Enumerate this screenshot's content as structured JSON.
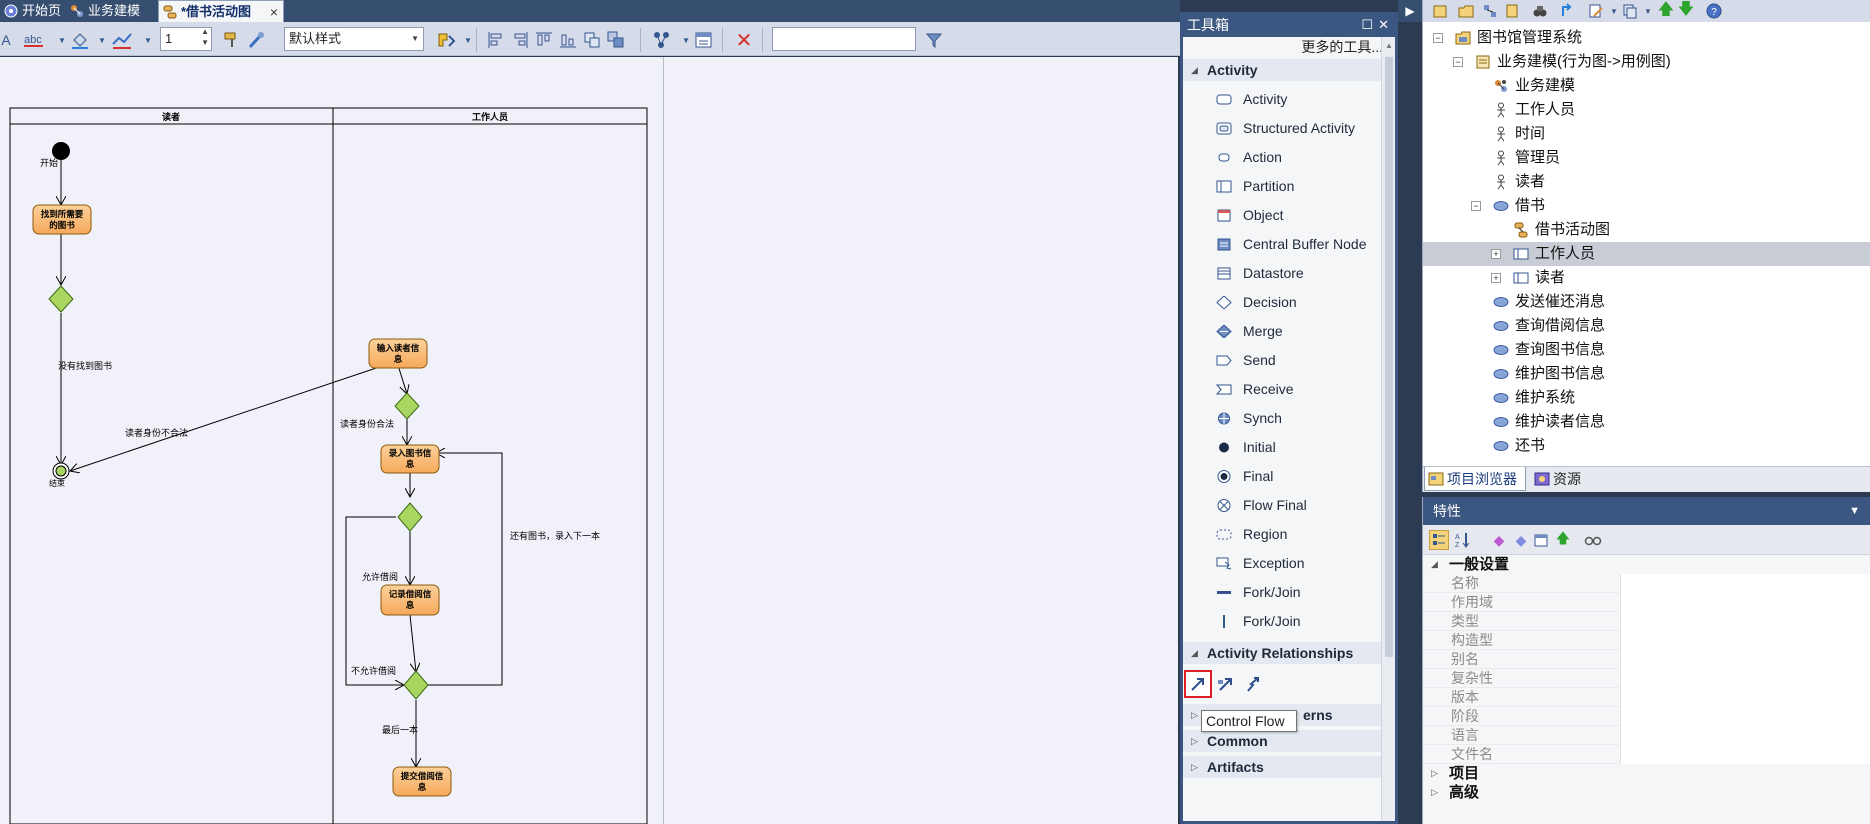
{
  "tabs": [
    {
      "label": "开始页",
      "active": false
    },
    {
      "label": "业务建模",
      "active": false
    },
    {
      "label": "*借书活动图",
      "active": true,
      "close": "×"
    }
  ],
  "toolbar": {
    "zoom_value": "1",
    "style_value": "默认样式",
    "search_value": ""
  },
  "diagram": {
    "lane_left": "读者",
    "lane_right": "工作人员",
    "start_label": "开始",
    "end_label": "结束",
    "nodes": {
      "find_book": [
        "找到所需要",
        "的图书"
      ],
      "enter_reader": [
        "输入读者信",
        "息"
      ],
      "enter_book": [
        "录入图书信",
        "息"
      ],
      "record_borrow": [
        "记录借阅信",
        "息"
      ],
      "submit_borrow": [
        "提交借阅信",
        "息"
      ]
    },
    "edges": {
      "not_found": "没有找到图书",
      "reader_invalid": "读者身份不合法",
      "reader_valid": "读者身份合法",
      "allow_borrow": "允许借阅",
      "has_more": "还有图书，录入下一本",
      "not_allowed": "不允许借阅",
      "last_one": "最后一本"
    }
  },
  "toolbox": {
    "title": "工具箱",
    "more_tools": "更多的工具...",
    "group_activity": "Activity",
    "tools": [
      {
        "label": "Activity",
        "icon": "activity-icon"
      },
      {
        "label": "Structured Activity",
        "icon": "structured-activity-icon"
      },
      {
        "label": "Action",
        "icon": "action-icon"
      },
      {
        "label": "Partition",
        "icon": "partition-icon"
      },
      {
        "label": "Object",
        "icon": "object-icon"
      },
      {
        "label": "Central Buffer Node",
        "icon": "central-buffer-icon"
      },
      {
        "label": "Datastore",
        "icon": "datastore-icon"
      },
      {
        "label": "Decision",
        "icon": "decision-icon"
      },
      {
        "label": "Merge",
        "icon": "merge-icon"
      },
      {
        "label": "Send",
        "icon": "send-icon"
      },
      {
        "label": "Receive",
        "icon": "receive-icon"
      },
      {
        "label": "Synch",
        "icon": "synch-icon"
      },
      {
        "label": "Initial",
        "icon": "initial-icon"
      },
      {
        "label": "Final",
        "icon": "final-icon"
      },
      {
        "label": "Flow Final",
        "icon": "flow-final-icon"
      },
      {
        "label": "Region",
        "icon": "region-icon"
      },
      {
        "label": "Exception",
        "icon": "exception-icon"
      },
      {
        "label": "Fork/Join",
        "icon": "fork-join-horizontal-icon"
      },
      {
        "label": "Fork/Join",
        "icon": "fork-join-vertical-icon"
      }
    ],
    "group_relationships": "Activity Relationships",
    "group_patterns_tail": "erns",
    "group_common": "Common",
    "group_artifacts": "Artifacts",
    "tooltip": "Control Flow"
  },
  "browser": {
    "tree": [
      {
        "label": "图书馆管理系统",
        "level": 0,
        "expander": "−",
        "icon": "package-icon"
      },
      {
        "label": "业务建模(行为图->用例图)",
        "level": 1,
        "expander": "−",
        "icon": "diagram-icon"
      },
      {
        "label": "业务建模",
        "level": 2,
        "icon": "business-model-icon"
      },
      {
        "label": "工作人员",
        "level": 2,
        "icon": "actor-icon"
      },
      {
        "label": "时间",
        "level": 2,
        "icon": "actor-icon"
      },
      {
        "label": "管理员",
        "level": 2,
        "icon": "actor-icon"
      },
      {
        "label": "读者",
        "level": 2,
        "icon": "actor-icon"
      },
      {
        "label": "借书",
        "level": 2,
        "expander": "−",
        "icon": "usecase-icon"
      },
      {
        "label": "借书活动图",
        "level": 3,
        "icon": "activity-diagram-icon"
      },
      {
        "label": "工作人员",
        "level": 3,
        "expander": "+",
        "icon": "partition-icon",
        "selected": true
      },
      {
        "label": "读者",
        "level": 3,
        "expander": "+",
        "icon": "partition-icon"
      },
      {
        "label": "发送催还消息",
        "level": 2,
        "icon": "usecase-icon"
      },
      {
        "label": "查询借阅信息",
        "level": 2,
        "icon": "usecase-icon"
      },
      {
        "label": "查询图书信息",
        "level": 2,
        "icon": "usecase-icon"
      },
      {
        "label": "维护图书信息",
        "level": 2,
        "icon": "usecase-icon"
      },
      {
        "label": "维护系统",
        "level": 2,
        "icon": "usecase-icon"
      },
      {
        "label": "维护读者信息",
        "level": 2,
        "icon": "usecase-icon"
      },
      {
        "label": "还书",
        "level": 2,
        "icon": "usecase-icon"
      }
    ],
    "tabs": [
      {
        "label": "项目浏览器",
        "active": true
      },
      {
        "label": "资源",
        "active": false
      }
    ]
  },
  "properties": {
    "title": "特性",
    "general_section": "一般设置",
    "rows": [
      "名称",
      "作用域",
      "类型",
      "构造型",
      "别名",
      "复杂性",
      "版本",
      "阶段",
      "语言",
      "文件名"
    ],
    "project_section": "项目",
    "advanced_section": "高级"
  }
}
